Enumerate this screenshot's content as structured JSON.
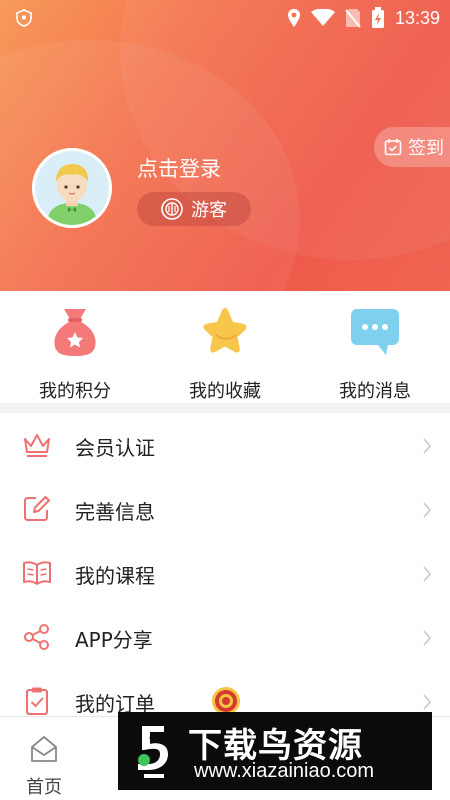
{
  "status_bar": {
    "time": "13:39",
    "icons": [
      "shield-icon",
      "location-icon",
      "wifi-icon",
      "no-sim-icon",
      "battery-charging-icon"
    ]
  },
  "header": {
    "signin_label": "签到",
    "login_text": "点击登录",
    "guest_label": "游客",
    "gradient_colors": [
      "#f79a5a",
      "#ef5a4a"
    ]
  },
  "quick_actions": [
    {
      "label": "我的积分",
      "icon": "money-bag-icon",
      "color": "#f47a7a"
    },
    {
      "label": "我的收藏",
      "icon": "star-icon",
      "color": "#f7c64a"
    },
    {
      "label": "我的消息",
      "icon": "chat-bubble-icon",
      "color": "#7fd0ee"
    }
  ],
  "menu": [
    {
      "label": "会员认证",
      "icon": "crown-icon"
    },
    {
      "label": "完善信息",
      "icon": "edit-icon"
    },
    {
      "label": "我的课程",
      "icon": "book-icon"
    },
    {
      "label": "APP分享",
      "icon": "share-icon"
    },
    {
      "label": "我的订单",
      "icon": "clipboard-icon"
    }
  ],
  "bottom_nav": {
    "home_label": "首页"
  },
  "watermark": {
    "title": "下载鸟资源",
    "url": "www.xiazainiao.com"
  },
  "colors": {
    "accent": "#f0605a",
    "menu_icon": "#f07070"
  }
}
